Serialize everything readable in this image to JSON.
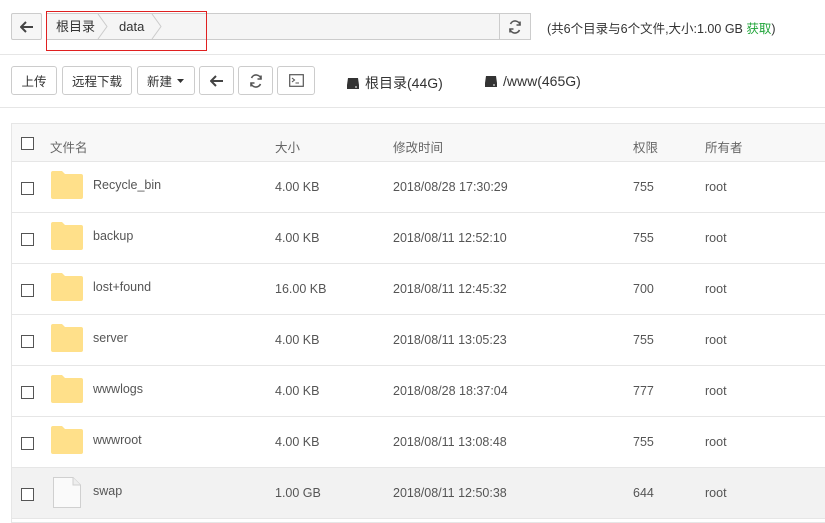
{
  "path_bar": {
    "crumbs": [
      "根目录",
      "data"
    ],
    "summary_text": "(共6个目录与6个文件,大小:1.00 GB ",
    "summary_link": "获取",
    "summary_close": ")"
  },
  "toolbar": {
    "upload": "上传",
    "remote_download": "远程下载",
    "new": "新建",
    "disks": [
      {
        "label": "根目录(44G)"
      },
      {
        "label": "/www(465G)"
      }
    ]
  },
  "table": {
    "headers": {
      "name": "文件名",
      "size": "大小",
      "mtime": "修改时间",
      "perm": "权限",
      "owner": "所有者"
    },
    "rows": [
      {
        "type": "folder",
        "name": "Recycle_bin",
        "size": "4.00 KB",
        "mtime": "2018/08/28 17:30:29",
        "perm": "755",
        "owner": "root"
      },
      {
        "type": "folder",
        "name": "backup",
        "size": "4.00 KB",
        "mtime": "2018/08/11 12:52:10",
        "perm": "755",
        "owner": "root"
      },
      {
        "type": "folder",
        "name": "lost+found",
        "size": "16.00 KB",
        "mtime": "2018/08/11 12:45:32",
        "perm": "700",
        "owner": "root"
      },
      {
        "type": "folder",
        "name": "server",
        "size": "4.00 KB",
        "mtime": "2018/08/11 13:05:23",
        "perm": "755",
        "owner": "root"
      },
      {
        "type": "folder",
        "name": "wwwlogs",
        "size": "4.00 KB",
        "mtime": "2018/08/28 18:37:04",
        "perm": "777",
        "owner": "root"
      },
      {
        "type": "folder",
        "name": "wwwroot",
        "size": "4.00 KB",
        "mtime": "2018/08/11 13:08:48",
        "perm": "755",
        "owner": "root"
      },
      {
        "type": "file",
        "name": "swap",
        "size": "1.00 GB",
        "mtime": "2018/08/11 12:50:38",
        "perm": "644",
        "owner": "root"
      }
    ]
  },
  "colors": {
    "accent_green": "#20a53a",
    "folder_yellow": "#ffe08a",
    "highlight_red": "#e02020"
  }
}
